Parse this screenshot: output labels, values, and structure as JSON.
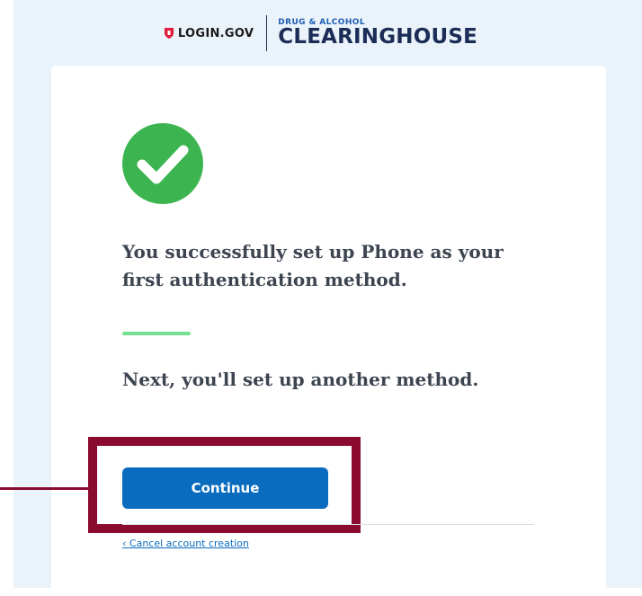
{
  "header": {
    "login_brand": "LOGIN.GOV",
    "partner_small": "DRUG & ALCOHOL",
    "partner_big": "CLEARINGHOUSE"
  },
  "main": {
    "success_icon": "check-circle-icon",
    "headline": "You successfully set up Phone as your first authentication method.",
    "next_text": "Next, you'll set up another method.",
    "continue_label": "Continue",
    "cancel_link": "‹ Cancel account creation"
  },
  "colors": {
    "primary": "#0a6cbf",
    "success": "#3cb550",
    "accent_rule": "#75e190",
    "highlight": "#8a0b2f",
    "background": "#eaf2fa"
  }
}
